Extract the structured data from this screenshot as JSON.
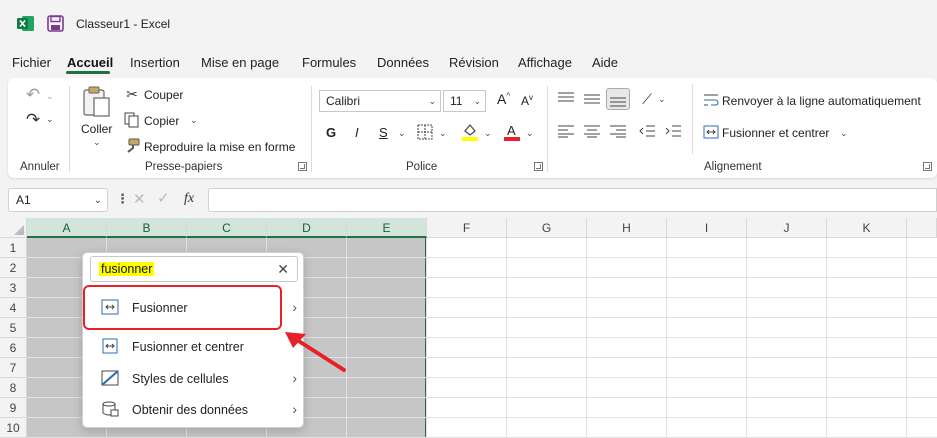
{
  "titlebar": {
    "title": "Classeur1  -  Excel"
  },
  "menu": {
    "tabs": [
      {
        "label": "Fichier"
      },
      {
        "label": "Accueil"
      },
      {
        "label": "Insertion"
      },
      {
        "label": "Mise en page"
      },
      {
        "label": "Formules"
      },
      {
        "label": "Données"
      },
      {
        "label": "Révision"
      },
      {
        "label": "Affichage"
      },
      {
        "label": "Aide"
      }
    ],
    "active": "Accueil"
  },
  "ribbon": {
    "annuler": {
      "label": "Annuler"
    },
    "clipboard": {
      "paste": "Coller",
      "cut": "Couper",
      "copy": "Copier",
      "format_painter": "Reproduire la mise en forme",
      "label": "Presse-papiers"
    },
    "font": {
      "name": "Calibri",
      "size": "11",
      "bold": "G",
      "italic": "I",
      "underline": "S",
      "grow": "A",
      "shrink": "A",
      "label": "Police",
      "highlight_color": "#ffff00",
      "font_color": "#e8202a"
    },
    "alignment": {
      "wrap": "Renvoyer à la ligne automatiquement",
      "merge_center": "Fusionner et centrer",
      "label": "Alignement"
    }
  },
  "formula_bar": {
    "name_box": "A1",
    "fx": "fx",
    "value": ""
  },
  "grid": {
    "columns": [
      "A",
      "B",
      "C",
      "D",
      "E",
      "F",
      "G",
      "H",
      "I",
      "J",
      "K"
    ],
    "rows": [
      "1",
      "2",
      "3",
      "4",
      "5",
      "6",
      "7",
      "8",
      "9",
      "10"
    ],
    "accent": "#217346"
  },
  "popup": {
    "search_value": "fusionner",
    "items": [
      {
        "label": "Fusionner",
        "submenu": true
      },
      {
        "label": "Fusionner et centrer",
        "submenu": false
      },
      {
        "label": "Styles de cellules",
        "submenu": true
      },
      {
        "label": "Obtenir des données",
        "submenu": true
      }
    ]
  },
  "annotation": {
    "color": "#e8202a"
  }
}
